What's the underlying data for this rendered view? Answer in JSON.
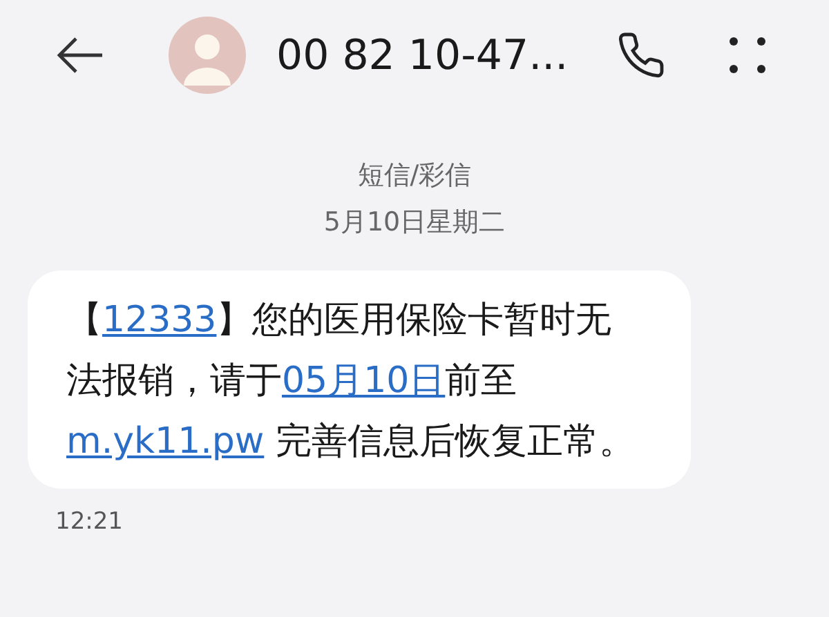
{
  "header": {
    "title": "00 82 10-47..."
  },
  "thread_info": {
    "channel": "短信/彩信",
    "date": "5月10日星期二"
  },
  "message": {
    "parts": [
      {
        "kind": "text",
        "text": "【"
      },
      {
        "kind": "link",
        "text": "12333"
      },
      {
        "kind": "text",
        "text": "】您的医用保险卡暂时无法报销，请于"
      },
      {
        "kind": "link",
        "text": "05月10日"
      },
      {
        "kind": "text",
        "text": "前至"
      },
      {
        "kind": "link",
        "text": "m.yk11.pw"
      },
      {
        "kind": "text",
        "text": " 完善信息后恢复正常。"
      }
    ],
    "time": "12:21"
  }
}
